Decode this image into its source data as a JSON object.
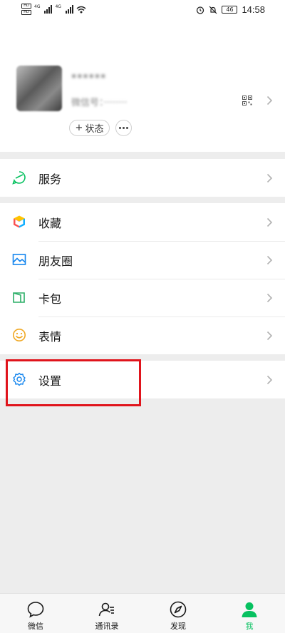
{
  "status_bar": {
    "sim1": "HD",
    "sim2": "HD",
    "net1": "4G",
    "net2": "4G",
    "battery": "46",
    "time": "14:58"
  },
  "profile": {
    "nickname": "······",
    "wechat_id_prefix": "微信号：········",
    "status_button": "状态",
    "status_plus": "+"
  },
  "menu": {
    "services": "服务",
    "favorites": "收藏",
    "moments": "朋友圈",
    "cards": "卡包",
    "stickers": "表情",
    "settings": "设置"
  },
  "tabs": [
    {
      "label": "微信",
      "icon": "chat-bubble-icon",
      "active": false
    },
    {
      "label": "通讯录",
      "icon": "contacts-icon",
      "active": false
    },
    {
      "label": "发现",
      "icon": "compass-icon",
      "active": false
    },
    {
      "label": "我",
      "icon": "person-icon",
      "active": true
    }
  ],
  "colors": {
    "accent_green": "#07c160",
    "highlight_red": "#e0141c",
    "background": "#ededed"
  }
}
